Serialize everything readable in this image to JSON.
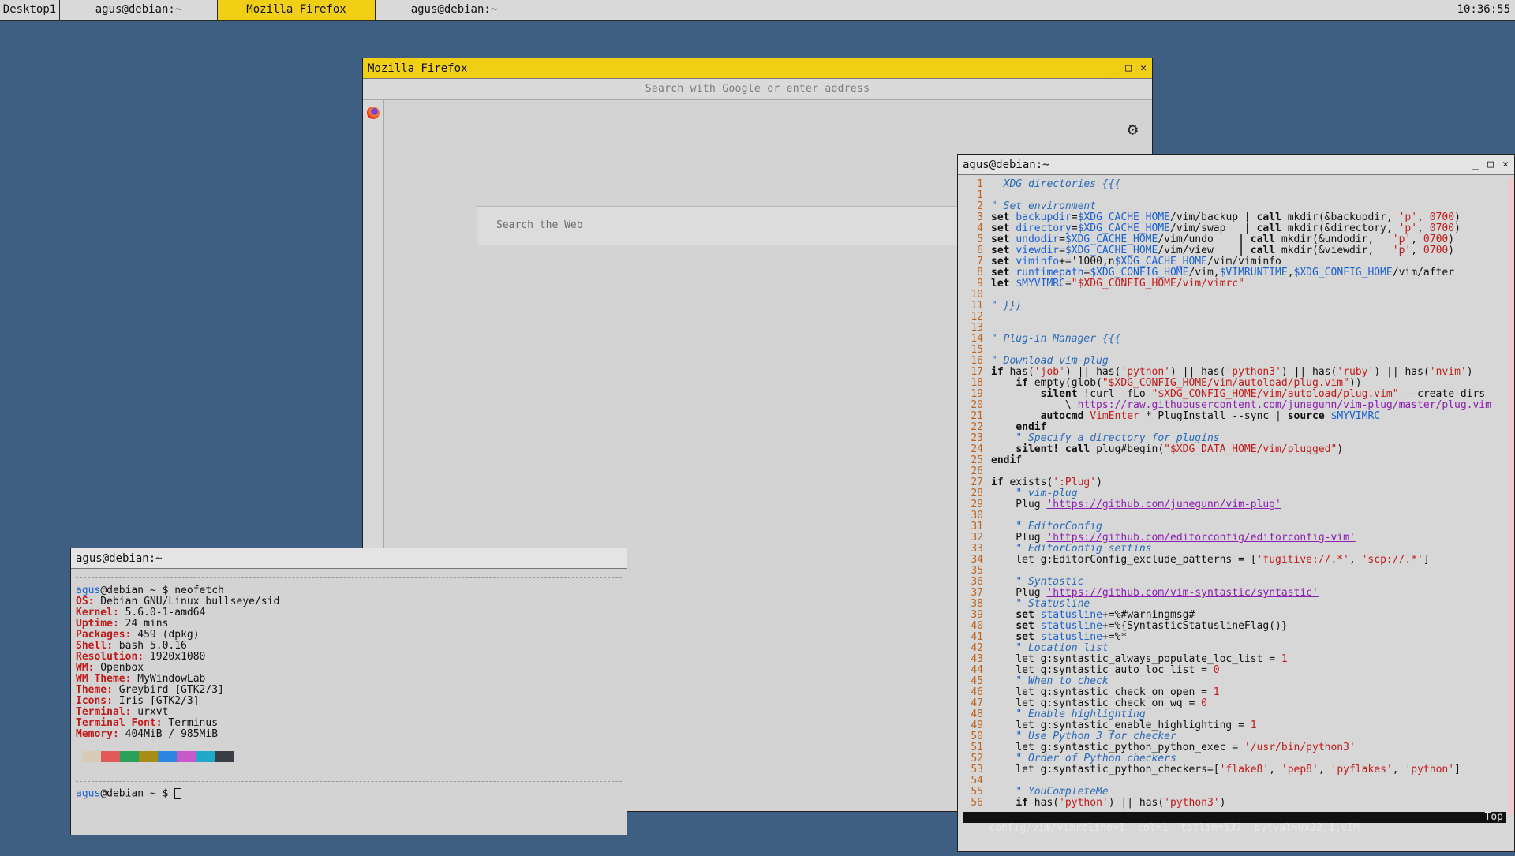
{
  "taskbar": {
    "items": [
      {
        "label": "Desktop1"
      },
      {
        "label": "agus@debian:~"
      },
      {
        "label": "Mozilla Firefox"
      },
      {
        "label": "agus@debian:~"
      }
    ],
    "clock": "10:36:55"
  },
  "firefox": {
    "title": "Mozilla Firefox",
    "url_placeholder": "Search with Google or enter address",
    "search_placeholder": "Search the Web"
  },
  "term_small": {
    "title": "agus@debian:~",
    "prompt_user": "agus",
    "prompt_host": "@debian ~ $ ",
    "command": "neofetch",
    "info": [
      {
        "k": "OS:",
        "v": " Debian GNU/Linux bullseye/sid"
      },
      {
        "k": "Kernel:",
        "v": " 5.6.0-1-amd64"
      },
      {
        "k": "Uptime:",
        "v": " 24 mins"
      },
      {
        "k": "Packages:",
        "v": " 459 (dpkg)"
      },
      {
        "k": "Shell:",
        "v": " bash 5.0.16"
      },
      {
        "k": "Resolution:",
        "v": " 1920x1080"
      },
      {
        "k": "WM:",
        "v": " Openbox"
      },
      {
        "k": "WM Theme:",
        "v": " MyWindowLab"
      },
      {
        "k": "Theme:",
        "v": " Greybird [GTK2/3]"
      },
      {
        "k": "Icons:",
        "v": " Iris [GTK2/3]"
      },
      {
        "k": "Terminal:",
        "v": " urxvt"
      },
      {
        "k": "Terminal Font:",
        "v": " Terminus"
      },
      {
        "k": "Memory:",
        "v": " 404MiB / 985MiB"
      }
    ],
    "palette": [
      "#d8ccb8",
      "#e05a5a",
      "#2aa05a",
      "#a88c14",
      "#2a86e0",
      "#c65ac8",
      "#20a8c8",
      "#3a3f47"
    ]
  },
  "term_vim": {
    "title": "agus@debian:~",
    "lines": [
      [
        [
          "ln",
          "1"
        ],
        [
          "txt",
          "  "
        ],
        [
          "cm",
          "XDG directories {{{"
        ]
      ],
      [
        [
          "ln",
          "1"
        ]
      ],
      [
        [
          "ln",
          "2"
        ],
        [
          "cm",
          "\" Set environment"
        ]
      ],
      [
        [
          "ln",
          "3"
        ],
        [
          "kw",
          "set "
        ],
        [
          "var",
          "backupdir"
        ],
        [
          "txt",
          "="
        ],
        [
          "var",
          "$XDG_CACHE_HOME"
        ],
        [
          "txt",
          "/vim/backup "
        ],
        [
          "kw",
          "| call "
        ],
        [
          "txt",
          "mkdir(&backupdir, "
        ],
        [
          "str",
          "'p'"
        ],
        [
          "txt",
          ", "
        ],
        [
          "str",
          "0700"
        ],
        [
          "txt",
          ")"
        ]
      ],
      [
        [
          "ln",
          "4"
        ],
        [
          "kw",
          "set "
        ],
        [
          "var",
          "directory"
        ],
        [
          "txt",
          "="
        ],
        [
          "var",
          "$XDG_CACHE_HOME"
        ],
        [
          "txt",
          "/vim/swap   "
        ],
        [
          "kw",
          "| call "
        ],
        [
          "txt",
          "mkdir(&directory, "
        ],
        [
          "str",
          "'p'"
        ],
        [
          "txt",
          ", "
        ],
        [
          "str",
          "0700"
        ],
        [
          "txt",
          ")"
        ]
      ],
      [
        [
          "ln",
          "5"
        ],
        [
          "kw",
          "set "
        ],
        [
          "var",
          "undodir"
        ],
        [
          "txt",
          "="
        ],
        [
          "var",
          "$XDG_CACHE_HOME"
        ],
        [
          "txt",
          "/vim/undo    "
        ],
        [
          "kw",
          "| call "
        ],
        [
          "txt",
          "mkdir(&undodir,   "
        ],
        [
          "str",
          "'p'"
        ],
        [
          "txt",
          ", "
        ],
        [
          "str",
          "0700"
        ],
        [
          "txt",
          ")"
        ]
      ],
      [
        [
          "ln",
          "6"
        ],
        [
          "kw",
          "set "
        ],
        [
          "var",
          "viewdir"
        ],
        [
          "txt",
          "="
        ],
        [
          "var",
          "$XDG_CACHE_HOME"
        ],
        [
          "txt",
          "/vim/view    "
        ],
        [
          "kw",
          "| call "
        ],
        [
          "txt",
          "mkdir(&viewdir,   "
        ],
        [
          "str",
          "'p'"
        ],
        [
          "txt",
          ", "
        ],
        [
          "str",
          "0700"
        ],
        [
          "txt",
          ")"
        ]
      ],
      [
        [
          "ln",
          "7"
        ],
        [
          "kw",
          "set "
        ],
        [
          "var",
          "viminfo"
        ],
        [
          "txt",
          "+='1000,n"
        ],
        [
          "var",
          "$XDG_CACHE_HOME"
        ],
        [
          "txt",
          "/vim/viminfo"
        ]
      ],
      [
        [
          "ln",
          "8"
        ],
        [
          "kw",
          "set "
        ],
        [
          "var",
          "runtimepath"
        ],
        [
          "txt",
          "="
        ],
        [
          "var",
          "$XDG_CONFIG_HOME"
        ],
        [
          "txt",
          "/vim,"
        ],
        [
          "var",
          "$VIMRUNTIME"
        ],
        [
          "txt",
          ","
        ],
        [
          "var",
          "$XDG_CONFIG_HOME"
        ],
        [
          "txt",
          "/vim/after"
        ]
      ],
      [
        [
          "ln",
          "9"
        ],
        [
          "kw",
          "let "
        ],
        [
          "var",
          "$MYVIMRC"
        ],
        [
          "txt",
          "="
        ],
        [
          "str",
          "\"$XDG_CONFIG_HOME/vim/vimrc\""
        ]
      ],
      [
        [
          "ln",
          "10"
        ]
      ],
      [
        [
          "ln",
          "11"
        ],
        [
          "cm",
          "\" }}}"
        ]
      ],
      [
        [
          "ln",
          "12"
        ]
      ],
      [
        [
          "ln",
          "13"
        ]
      ],
      [
        [
          "ln",
          "14"
        ],
        [
          "cm",
          "\" Plug-in Manager {{{"
        ]
      ],
      [
        [
          "ln",
          "15"
        ]
      ],
      [
        [
          "ln",
          "16"
        ],
        [
          "cm",
          "\" Download vim-plug"
        ]
      ],
      [
        [
          "ln",
          "17"
        ],
        [
          "kw",
          "if "
        ],
        [
          "txt",
          "has("
        ],
        [
          "str",
          "'job'"
        ],
        [
          "txt",
          ") || has("
        ],
        [
          "str",
          "'python'"
        ],
        [
          "txt",
          ") || has("
        ],
        [
          "str",
          "'python3'"
        ],
        [
          "txt",
          ") || has("
        ],
        [
          "str",
          "'ruby'"
        ],
        [
          "txt",
          ") || has("
        ],
        [
          "str",
          "'nvim'"
        ],
        [
          "txt",
          ")"
        ]
      ],
      [
        [
          "ln",
          "18"
        ],
        [
          "txt",
          "    "
        ],
        [
          "kw",
          "if "
        ],
        [
          "txt",
          "empty(glob("
        ],
        [
          "str",
          "\"$XDG_CONFIG_HOME/vim/autoload/plug.vim\""
        ],
        [
          "txt",
          "))"
        ]
      ],
      [
        [
          "ln",
          "19"
        ],
        [
          "txt",
          "        "
        ],
        [
          "kw",
          "silent "
        ],
        [
          "txt",
          "!curl -fLo "
        ],
        [
          "str",
          "\"$XDG_CONFIG_HOME/vim/autoload/plug.vim\""
        ],
        [
          "txt",
          " --create-dirs"
        ]
      ],
      [
        [
          "ln",
          "20"
        ],
        [
          "txt",
          "            \\ "
        ],
        [
          "url",
          "https://raw.githubusercontent.com/junegunn/vim-plug/master/plug.vim"
        ]
      ],
      [
        [
          "ln",
          "21"
        ],
        [
          "txt",
          "        "
        ],
        [
          "kw",
          "autocmd "
        ],
        [
          "str",
          "VimEnter"
        ],
        [
          "txt",
          " * PlugInstall --sync | "
        ],
        [
          "kw",
          "source "
        ],
        [
          "var",
          "$MYVIMRC"
        ]
      ],
      [
        [
          "ln",
          "22"
        ],
        [
          "txt",
          "    "
        ],
        [
          "kw",
          "endif"
        ]
      ],
      [
        [
          "ln",
          "23"
        ],
        [
          "txt",
          "    "
        ],
        [
          "cm",
          "\" Specify a directory for plugins"
        ]
      ],
      [
        [
          "ln",
          "24"
        ],
        [
          "txt",
          "    "
        ],
        [
          "kw",
          "silent! call "
        ],
        [
          "txt",
          "plug#begin("
        ],
        [
          "str",
          "\"$XDG_DATA_HOME/vim/plugged\""
        ],
        [
          "txt",
          ")"
        ]
      ],
      [
        [
          "ln",
          "25"
        ],
        [
          "kw",
          "endif"
        ]
      ],
      [
        [
          "ln",
          "26"
        ]
      ],
      [
        [
          "ln",
          "27"
        ],
        [
          "kw",
          "if "
        ],
        [
          "txt",
          "exists("
        ],
        [
          "str",
          "':Plug'"
        ],
        [
          "txt",
          ")"
        ]
      ],
      [
        [
          "ln",
          "28"
        ],
        [
          "txt",
          "    "
        ],
        [
          "cm",
          "\" vim-plug"
        ]
      ],
      [
        [
          "ln",
          "29"
        ],
        [
          "txt",
          "    Plug "
        ],
        [
          "url",
          "'https://github.com/junegunn/vim-plug'"
        ]
      ],
      [
        [
          "ln",
          "30"
        ]
      ],
      [
        [
          "ln",
          "31"
        ],
        [
          "txt",
          "    "
        ],
        [
          "cm",
          "\" EditorConfig"
        ]
      ],
      [
        [
          "ln",
          "32"
        ],
        [
          "txt",
          "    Plug "
        ],
        [
          "url",
          "'https://github.com/editorconfig/editorconfig-vim'"
        ]
      ],
      [
        [
          "ln",
          "33"
        ],
        [
          "txt",
          "    "
        ],
        [
          "cm",
          "\" EditorConfig settins"
        ]
      ],
      [
        [
          "ln",
          "34"
        ],
        [
          "txt",
          "    let g:EditorConfig_exclude_patterns = ["
        ],
        [
          "str",
          "'fugitive://.*'"
        ],
        [
          "txt",
          ", "
        ],
        [
          "str",
          "'scp://.*'"
        ],
        [
          "txt",
          "]"
        ]
      ],
      [
        [
          "ln",
          "35"
        ]
      ],
      [
        [
          "ln",
          "36"
        ],
        [
          "txt",
          "    "
        ],
        [
          "cm",
          "\" Syntastic"
        ]
      ],
      [
        [
          "ln",
          "37"
        ],
        [
          "txt",
          "    Plug "
        ],
        [
          "url",
          "'https://github.com/vim-syntastic/syntastic'"
        ]
      ],
      [
        [
          "ln",
          "38"
        ],
        [
          "txt",
          "    "
        ],
        [
          "cm",
          "\" Statusline"
        ]
      ],
      [
        [
          "ln",
          "39"
        ],
        [
          "txt",
          "    "
        ],
        [
          "kw",
          "set "
        ],
        [
          "var",
          "statusline"
        ],
        [
          "txt",
          "+=%#warningmsg#"
        ]
      ],
      [
        [
          "ln",
          "40"
        ],
        [
          "txt",
          "    "
        ],
        [
          "kw",
          "set "
        ],
        [
          "var",
          "statusline"
        ],
        [
          "txt",
          "+=%{SyntasticStatuslineFlag()}"
        ]
      ],
      [
        [
          "ln",
          "41"
        ],
        [
          "txt",
          "    "
        ],
        [
          "kw",
          "set "
        ],
        [
          "var",
          "statusline"
        ],
        [
          "txt",
          "+=%*"
        ]
      ],
      [
        [
          "ln",
          "42"
        ],
        [
          "txt",
          "    "
        ],
        [
          "cm",
          "\" Location list"
        ]
      ],
      [
        [
          "ln",
          "43"
        ],
        [
          "txt",
          "    let g:syntastic_always_populate_loc_list = "
        ],
        [
          "str",
          "1"
        ]
      ],
      [
        [
          "ln",
          "44"
        ],
        [
          "txt",
          "    let g:syntastic_auto_loc_list = "
        ],
        [
          "str",
          "0"
        ]
      ],
      [
        [
          "ln",
          "45"
        ],
        [
          "txt",
          "    "
        ],
        [
          "cm",
          "\" When to check"
        ]
      ],
      [
        [
          "ln",
          "46"
        ],
        [
          "txt",
          "    let g:syntastic_check_on_open = "
        ],
        [
          "str",
          "1"
        ]
      ],
      [
        [
          "ln",
          "47"
        ],
        [
          "txt",
          "    let g:syntastic_check_on_wq = "
        ],
        [
          "str",
          "0"
        ]
      ],
      [
        [
          "ln",
          "48"
        ],
        [
          "txt",
          "    "
        ],
        [
          "cm",
          "\" Enable highlighting"
        ]
      ],
      [
        [
          "ln",
          "49"
        ],
        [
          "txt",
          "    let g:syntastic_enable_highlighting = "
        ],
        [
          "str",
          "1"
        ]
      ],
      [
        [
          "ln",
          "50"
        ],
        [
          "txt",
          "    "
        ],
        [
          "cm",
          "\" Use Python 3 for checker"
        ]
      ],
      [
        [
          "ln",
          "51"
        ],
        [
          "txt",
          "    let g:syntastic_python_python_exec = "
        ],
        [
          "str",
          "'/usr/bin/python3'"
        ]
      ],
      [
        [
          "ln",
          "52"
        ],
        [
          "txt",
          "    "
        ],
        [
          "cm",
          "\" Order of Python checkers"
        ]
      ],
      [
        [
          "ln",
          "53"
        ],
        [
          "txt",
          "    let g:syntastic_python_checkers=["
        ],
        [
          "str",
          "'flake8'"
        ],
        [
          "txt",
          ", "
        ],
        [
          "str",
          "'pep8'"
        ],
        [
          "txt",
          ", "
        ],
        [
          "str",
          "'pyflakes'"
        ],
        [
          "txt",
          ", "
        ],
        [
          "str",
          "'python'"
        ],
        [
          "txt",
          "]"
        ]
      ],
      [
        [
          "ln",
          "54"
        ]
      ],
      [
        [
          "ln",
          "55"
        ],
        [
          "txt",
          "    "
        ],
        [
          "cm",
          "\" YouCompleteMe"
        ]
      ],
      [
        [
          "ln",
          "56"
        ],
        [
          "txt",
          "    "
        ],
        [
          "kw",
          "if "
        ],
        [
          "txt",
          "has("
        ],
        [
          "str",
          "'python'"
        ],
        [
          "txt",
          ") || has("
        ],
        [
          "str",
          "'python3'"
        ],
        [
          "txt",
          ")"
        ]
      ]
    ],
    "status_left": "config/vim/vimrcline=1  col=1  totlin=537  bytval=0x22,1,VIM",
    "status_right": "Top"
  },
  "icons": {
    "minimize": "_",
    "maximize": "□",
    "close": "✕",
    "gear": "⚙"
  }
}
